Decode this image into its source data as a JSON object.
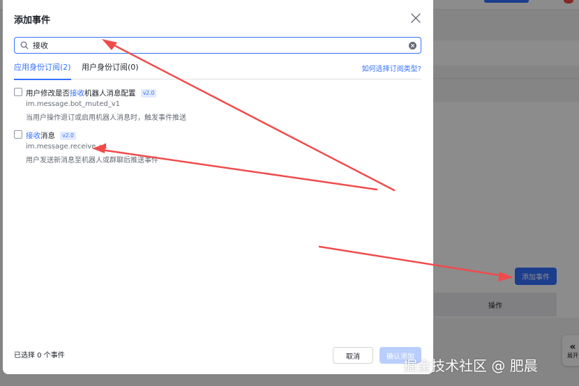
{
  "modal": {
    "title": "添加事件",
    "search": {
      "value": "接收",
      "placeholder": ""
    },
    "tabs": [
      {
        "label": "应用身份订阅(2)",
        "active": true
      },
      {
        "label": "用户身份订阅(0)",
        "active": false
      }
    ],
    "help_link": "如何选择订阅类型?",
    "events": [
      {
        "name_before": "用户修改是否",
        "name_highlight": "接收",
        "name_after": "机器人消息配置",
        "version": "v2.0",
        "code": "im.message.bot_muted_v1",
        "description": "当用户操作退订或启用机器人消息时，触发事件推送",
        "checked": false
      },
      {
        "name_before": "",
        "name_highlight": "接收",
        "name_after": "消息",
        "version": "v2.0",
        "code": "im.message.receive_v1",
        "description": "用户发送新消息至机器人或群聊后推送事件",
        "checked": false
      }
    ],
    "selected_count": "已选择 0 个事件",
    "cancel_label": "取消",
    "confirm_label": "确认添加"
  },
  "background": {
    "add_event_button": "添加事件",
    "table_header": "操作",
    "expand_label": "展开"
  },
  "watermark": "掘金技术社区 @ 肥晨",
  "colors": {
    "accent": "#3370ff",
    "annotation_arrow": "#f04b4b",
    "confirm_disabled": "#bacefd"
  },
  "icons": [
    "close-icon",
    "search-icon",
    "clear-icon",
    "chevron-double-left-icon"
  ]
}
